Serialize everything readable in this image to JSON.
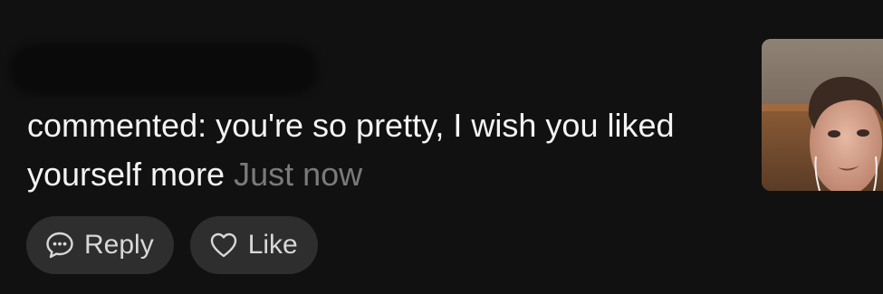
{
  "comment": {
    "text": "commented: you're so pretty, I wish you liked yourself more",
    "timestamp": "Just now"
  },
  "actions": {
    "reply_label": "Reply",
    "like_label": "Like"
  },
  "icons": {
    "reply": "chat-bubble-icon",
    "like": "heart-icon"
  },
  "colors": {
    "background": "#111111",
    "text": "#f4f4f4",
    "timestamp": "#7a7a7a",
    "button_bg": "#2e2e2e"
  }
}
